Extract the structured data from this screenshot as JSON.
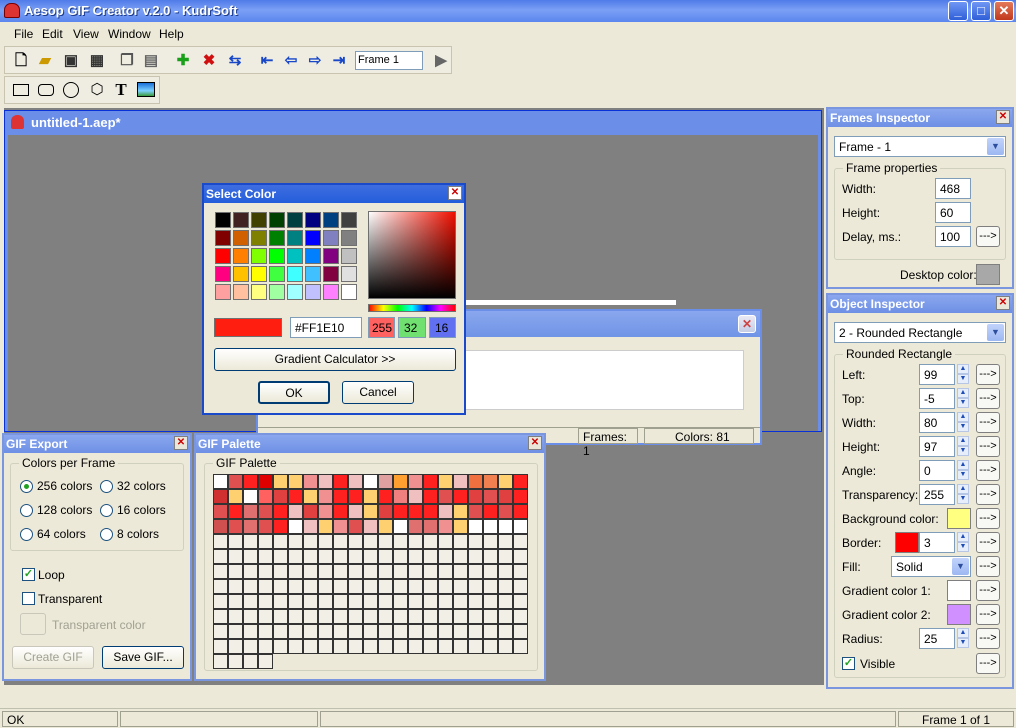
{
  "app": {
    "title": "Aesop GIF Creator v.2.0 - KudrSoft"
  },
  "menu": [
    "File",
    "Edit",
    "View",
    "Window",
    "Help"
  ],
  "toolbar": {
    "frame_value": "Frame 1"
  },
  "document": {
    "title": "untitled-1.aep*"
  },
  "behind_window": {
    "frames_label": "Frames: 1",
    "colors_label": "Colors: 81"
  },
  "select_color": {
    "title": "Select Color",
    "hex_value": "#FF1E10",
    "r": "255",
    "g": "32",
    "b": "16",
    "gradient_button": "Gradient Calculator >>",
    "ok": "OK",
    "cancel": "Cancel",
    "current_color": "#ff1e10",
    "basic_colors": [
      "#000000",
      "#402020",
      "#404000",
      "#004000",
      "#004040",
      "#000080",
      "#004080",
      "#404040",
      "#800000",
      "#d06000",
      "#808000",
      "#008000",
      "#008080",
      "#0000ff",
      "#8080c0",
      "#808080",
      "#ff0000",
      "#ff8000",
      "#80ff00",
      "#00ff00",
      "#00c0c0",
      "#0080ff",
      "#800080",
      "#c0c0c0",
      "#ff0080",
      "#ffc000",
      "#ffff00",
      "#40ff40",
      "#40ffff",
      "#40c0ff",
      "#800040",
      "#e0e0e0",
      "#ffa0a0",
      "#ffc0a0",
      "#ffff80",
      "#a0ffa0",
      "#a0ffff",
      "#c0c0ff",
      "#ff80ff",
      "#ffffff"
    ]
  },
  "frames_inspector": {
    "title": "Frames Inspector",
    "frame_select": "Frame - 1",
    "group_label": "Frame properties",
    "width_label": "Width:",
    "width": "468",
    "height_label": "Height:",
    "height": "60",
    "delay_label": "Delay, ms.:",
    "delay": "100",
    "desktop_color_label": "Desktop color:",
    "desktop_color": "#a8a8a8",
    "more": "--->"
  },
  "object_inspector": {
    "title": "Object Inspector",
    "object_select": "2 - Rounded Rectangle",
    "group_label": "Rounded Rectangle",
    "left_label": "Left:",
    "left": "99",
    "top_label": "Top:",
    "top": "-5",
    "width_label": "Width:",
    "width": "80",
    "height_label": "Height:",
    "height": "97",
    "angle_label": "Angle:",
    "angle": "0",
    "transparency_label": "Transparency:",
    "transparency": "255",
    "bg_color_label": "Background color:",
    "bg_color": "#ffff80",
    "border_label": "Border:",
    "border_color": "#ff0000",
    "border_width": "3",
    "fill_label": "Fill:",
    "fill": "Solid",
    "grad1_label": "Gradient color 1:",
    "grad1_color": "#ffffff",
    "grad2_label": "Gradient color 2:",
    "grad2_color": "#d090ff",
    "radius_label": "Radius:",
    "radius": "25",
    "visible_label": "Visible"
  },
  "gif_export": {
    "title": "GIF Export",
    "group_label": "Colors per Frame",
    "opt_256": "256 colors",
    "opt_32": "32 colors",
    "opt_128": "128 colors",
    "opt_16": "16 colors",
    "opt_64": "64 colors",
    "opt_8": "8 colors",
    "loop": "Loop",
    "transparent": "Transparent",
    "transparent_color": "Transparent color",
    "create_gif": "Create GIF",
    "save_gif": "Save GIF..."
  },
  "gif_palette": {
    "title": "GIF Palette",
    "group_label": "GIF Palette",
    "rows": [
      [
        "#ffffff",
        "#e05050",
        "#ff2020",
        "#e00000",
        "#ffd070",
        "#ffd070",
        "#f09090",
        "#f0c0c0",
        "#ff2020",
        "#f0c0c0",
        "#ffffff",
        "#e0a0a0",
        "#ffa030",
        "#f09090",
        "#ff2020",
        "#ffd070",
        "#f0c0c0",
        "#f07040",
        "#f08050",
        "#ffd070",
        "#ff2020"
      ],
      [
        "#d03030",
        "#ffd070",
        "#ffffff",
        "#ff6060",
        "#e04040",
        "#ff2020",
        "#ffd070",
        "#f09090",
        "#ff2020",
        "#ff2020",
        "#ffd070",
        "#ff2020",
        "#f08080",
        "#f0c0c0",
        "#ff2020",
        "#e05050",
        "#ff2020",
        "#e04040",
        "#e05050",
        "#e04040",
        "#ff2020"
      ],
      [
        "#e05050",
        "#ff2020",
        "#e07070",
        "#e05050",
        "#ff2020",
        "#f0c0c0",
        "#e04040",
        "#f09090",
        "#ff2020",
        "#f0c0c0",
        "#ffd070",
        "#e04040",
        "#ff2020",
        "#ff2020",
        "#ff2020",
        "#f0c0c0",
        "#ffd070",
        "#e05050",
        "#ff2020",
        "#e05050",
        "#ff2020"
      ],
      [
        "#d05050",
        "#e05050",
        "#e07070",
        "#e05050",
        "#ff2020",
        "#ffffff",
        "#f0c0c0",
        "#ffd070",
        "#f09090",
        "#e05050",
        "#f0c0c0",
        "#ffd070",
        "#ffffff",
        "#e07070",
        "#e07070",
        "#f09090",
        "#ffd070",
        "#ffffff",
        "#ffffff",
        "#ffffff",
        "#ffffff"
      ]
    ]
  }
}
